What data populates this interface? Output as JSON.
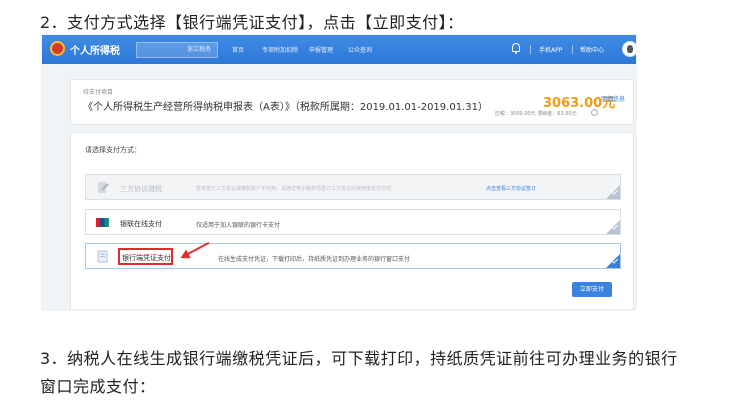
{
  "doc": {
    "step2": "2．支付方式选择【银行端凭证支付】，点击【立即支付】：",
    "step3_line1": "3．纳税人在线生成银行端缴税凭证后，可下载打印，持纸质凭证前往可办理业务的银行",
    "step3_line2": "窗口完成支付："
  },
  "screenshot": {
    "header": {
      "site_title": "个人所得税",
      "region": "浙江税务",
      "nav": [
        "首页",
        "专项附加扣除",
        "申报管理",
        "公众查询"
      ],
      "app_link": "手机APP",
      "help_link": "帮助中心"
    },
    "item": {
      "label": "待支付项目",
      "title": "《个人所得税生产经营所得纳税申报表（A表）》（税款所属期：2019.01.01-2019.01.31）",
      "amount": "3063.00元",
      "detail_link": "明细信息",
      "amount_detail": "应税：3000.00元  滞纳金：63.00元"
    },
    "methods": {
      "title": "请选择支付方式：",
      "third_party": {
        "name": "三方协议缴税",
        "desc": "暂未签订三方协议或缴款账户不可用，请通过电子税务局签订三方协议后使用本支付方式",
        "link": "点击查看三方协议签订"
      },
      "unionpay": {
        "name": "银联在线支付",
        "desc": "仅适用于加入银联的银行卡支付"
      },
      "bank_voucher": {
        "name": "银行端凭证支付",
        "desc": "在线生成支付凭证，下载打印后，持纸质凭证到办理业务的银行窗口支付"
      },
      "pay_button": "立即支付"
    }
  }
}
